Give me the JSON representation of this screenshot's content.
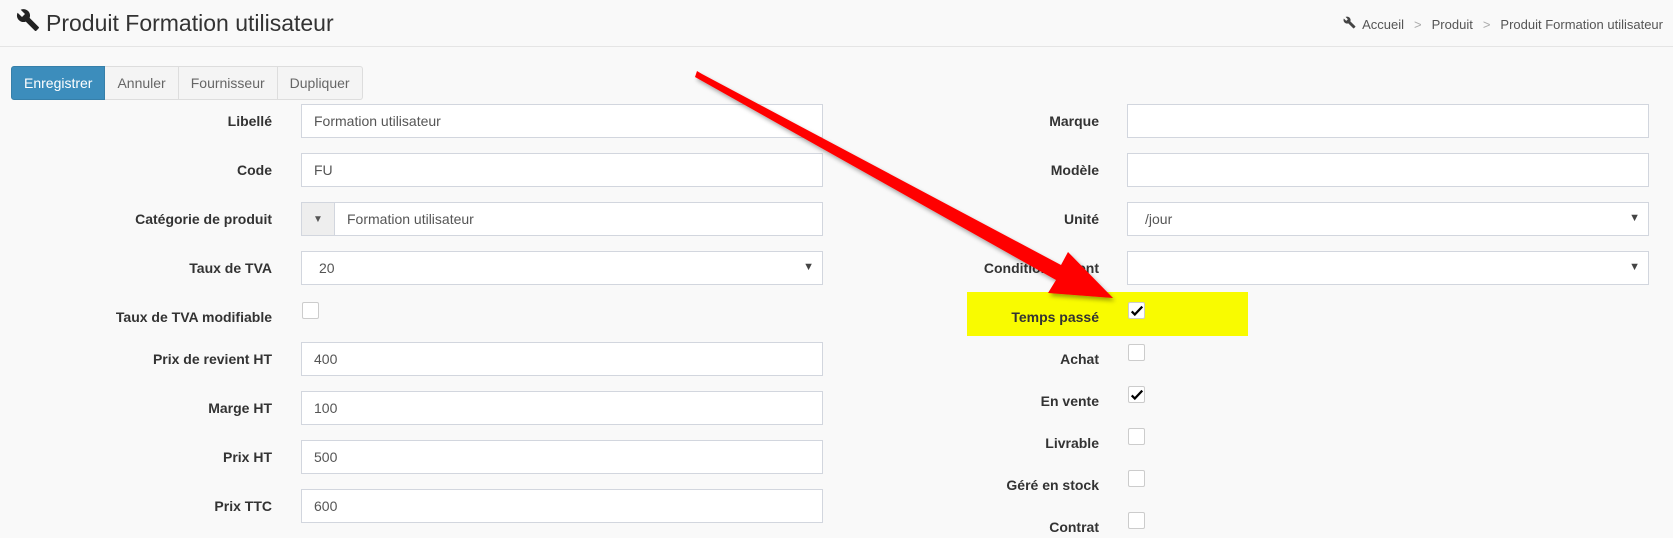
{
  "header": {
    "title": "Produit Formation utilisateur",
    "breadcrumb": [
      "Accueil",
      "Produit",
      "Produit Formation utilisateur"
    ]
  },
  "toolbar": {
    "save": "Enregistrer",
    "cancel": "Annuler",
    "supplier": "Fournisseur",
    "duplicate": "Dupliquer"
  },
  "left": {
    "libelle": {
      "label": "Libellé",
      "value": "Formation utilisateur"
    },
    "code": {
      "label": "Code",
      "value": "FU"
    },
    "categorie": {
      "label": "Catégorie de produit",
      "value": "Formation utilisateur"
    },
    "tva": {
      "label": "Taux de TVA",
      "value": "20"
    },
    "tva_mod": {
      "label": "Taux de TVA modifiable",
      "checked": false
    },
    "prix_revient": {
      "label": "Prix de revient HT",
      "value": "400"
    },
    "marge": {
      "label": "Marge HT",
      "value": "100"
    },
    "prix_ht": {
      "label": "Prix HT",
      "value": "500"
    },
    "prix_ttc": {
      "label": "Prix TTC",
      "value": "600"
    }
  },
  "right": {
    "marque": {
      "label": "Marque",
      "value": ""
    },
    "modele": {
      "label": "Modèle",
      "value": ""
    },
    "unite": {
      "label": "Unité",
      "value": "/jour"
    },
    "conditionnement": {
      "label": "Conditionnement",
      "value": ""
    },
    "temps_passe": {
      "label": "Temps passé",
      "checked": true
    },
    "achat": {
      "label": "Achat",
      "checked": false
    },
    "en_vente": {
      "label": "En vente",
      "checked": true
    },
    "livrable": {
      "label": "Livrable",
      "checked": false
    },
    "gere_stock": {
      "label": "Géré en stock",
      "checked": false
    },
    "contrat": {
      "label": "Contrat",
      "checked": false
    }
  },
  "colors": {
    "primary": "#3c8dbc",
    "highlight": "#f9fb00",
    "annotation_arrow": "#ff0000"
  },
  "icons": {
    "title": "wrench-icon",
    "breadcrumb": "wrench-icon",
    "dropdown": "caret-down-icon",
    "check": "checkmark-icon"
  }
}
